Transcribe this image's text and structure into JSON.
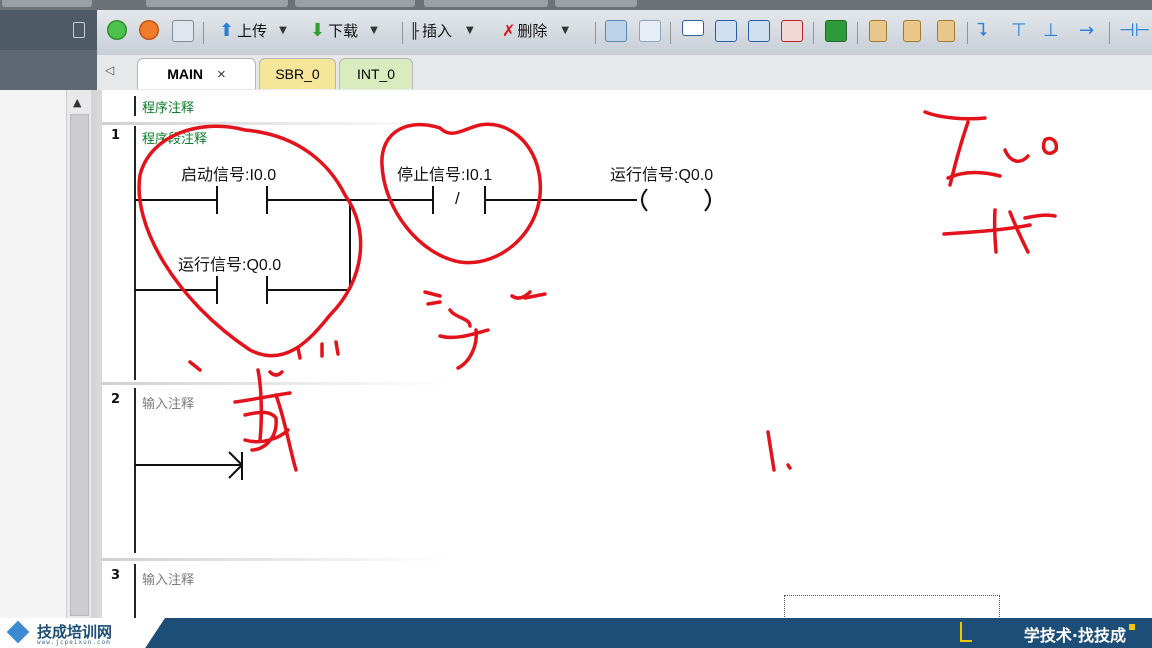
{
  "toolbar": {
    "upload_label": "上传",
    "download_label": "下载",
    "insert_label": "插入",
    "delete_label": "删除"
  },
  "tabs": [
    {
      "label": "MAIN",
      "close": "×"
    },
    {
      "label": "SBR_0"
    },
    {
      "label": "INT_0"
    }
  ],
  "program": {
    "comment": "程序注释",
    "networks": [
      {
        "number": "1",
        "comment": "程序段注释",
        "contacts": {
          "start": "启动信号:I0.0",
          "stop": "停止信号:I0.1",
          "stop_symbol": "/",
          "run_hold": "运行信号:Q0.0",
          "coil": "运行信号:Q0.0"
        }
      },
      {
        "number": "2",
        "comment": "输入注释"
      },
      {
        "number": "3",
        "comment": "输入注释"
      }
    ]
  },
  "footer": {
    "brand": "技成培训网",
    "url": "www.jcpeixun.com",
    "slogan": "学技术·找技成"
  },
  "colors": {
    "annotation_red": "#e3121b",
    "comment_green": "#0a7d2a",
    "footer_blue": "#1c4e78",
    "accent_yellow": "#f2c500"
  }
}
